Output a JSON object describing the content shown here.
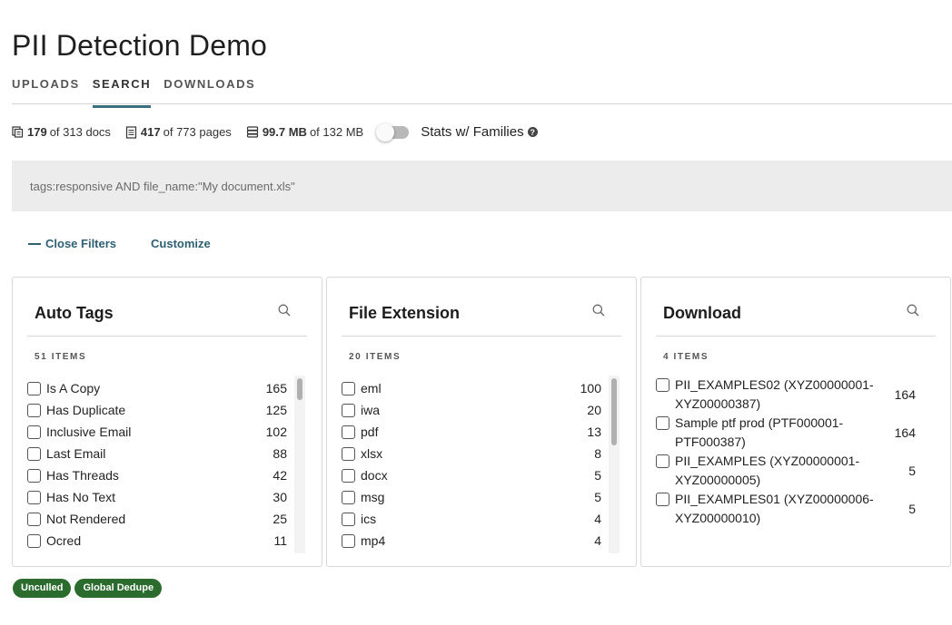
{
  "app": {
    "title": "PII Detection Demo"
  },
  "tabs": [
    {
      "label": "UPLOADS",
      "active": false
    },
    {
      "label": "SEARCH",
      "active": true
    },
    {
      "label": "DOWNLOADS",
      "active": false
    }
  ],
  "stats": {
    "docs": {
      "bold": "179",
      "rest": "of 313 docs",
      "icon": "documents-icon"
    },
    "pages": {
      "bold": "417",
      "rest": "of 773 pages",
      "icon": "page-icon"
    },
    "size": {
      "bold": "99.7 MB",
      "rest": "of 132 MB",
      "icon": "database-icon"
    },
    "toggle_label": "Stats w/ Families",
    "toggle_on": false
  },
  "search": {
    "placeholder": "tags:responsive AND file_name:\"My document.xls\"",
    "value": ""
  },
  "filters": {
    "close_label": "Close Filters",
    "customize_label": "Customize"
  },
  "panels": {
    "auto_tags": {
      "title": "Auto Tags",
      "items_count": "51 ITEMS",
      "items": [
        {
          "label": "Is A Copy",
          "count": "165"
        },
        {
          "label": "Has Duplicate",
          "count": "125"
        },
        {
          "label": "Inclusive Email",
          "count": "102"
        },
        {
          "label": "Last Email",
          "count": "88"
        },
        {
          "label": "Has Threads",
          "count": "42"
        },
        {
          "label": "Has No Text",
          "count": "30"
        },
        {
          "label": "Not Rendered",
          "count": "25"
        },
        {
          "label": "Ocred",
          "count": "11"
        }
      ]
    },
    "file_extension": {
      "title": "File Extension",
      "items_count": "20 ITEMS",
      "items": [
        {
          "label": "eml",
          "count": "100"
        },
        {
          "label": "iwa",
          "count": "20"
        },
        {
          "label": "pdf",
          "count": "13"
        },
        {
          "label": "xlsx",
          "count": "8"
        },
        {
          "label": "docx",
          "count": "5"
        },
        {
          "label": "msg",
          "count": "5"
        },
        {
          "label": "ics",
          "count": "4"
        },
        {
          "label": "mp4",
          "count": "4"
        }
      ]
    },
    "download": {
      "title": "Download",
      "items_count": "4 ITEMS",
      "items": [
        {
          "label": "PII_EXAMPLES02 (XYZ00000001-XYZ00000387)",
          "count": "164"
        },
        {
          "label": "Sample ptf prod (PTF000001-PTF000387)",
          "count": "164"
        },
        {
          "label": "PII_EXAMPLES (XYZ00000001-XYZ00000005)",
          "count": "5"
        },
        {
          "label": "PII_EXAMPLES01 (XYZ00000006-XYZ00000010)",
          "count": "5"
        }
      ]
    }
  },
  "badges": [
    "Unculled",
    "Global Dedupe"
  ],
  "colors": {
    "accent": "#3e6f80",
    "link": "#2f5f72",
    "badge": "#2b6b2e",
    "search_bg": "#ececec"
  }
}
